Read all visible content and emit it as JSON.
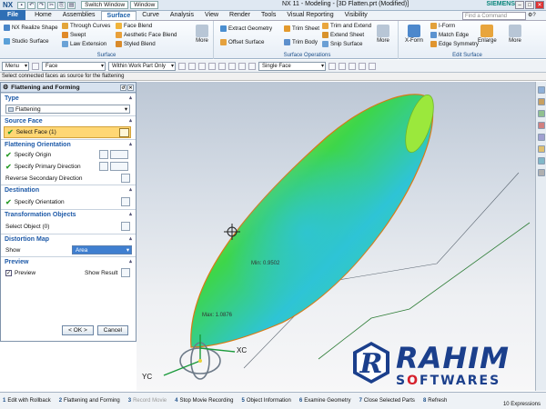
{
  "titlebar": {
    "app_logo": "NX",
    "switch_window": "Switch Window",
    "window_menu": "Window",
    "title": "NX 11 - Modeling - [3D Flatten.prt (Modified)]",
    "brand": "SIEMENS"
  },
  "menubar": {
    "file": "File",
    "tabs": [
      "Home",
      "Assemblies",
      "Surface",
      "Curve",
      "Analysis",
      "View",
      "Render",
      "Tools",
      "Visual Reporting",
      "Visibility"
    ],
    "active_tab": "Surface",
    "find_placeholder": "Find a Command"
  },
  "ribbon": {
    "groups": {
      "surface": "Surface",
      "surface_operations": "Surface Operations",
      "edit_surface": "Edit Surface"
    },
    "buttons": {
      "nx_realize_shape": "NX Realize Shape",
      "studio_surface": "Studio Surface",
      "through_curves": "Through Curves",
      "swept": "Swept",
      "law_extension": "Law Extension",
      "face_blend": "Face Blend",
      "aesthetic_face_blend": "Aesthetic Face Blend",
      "styled_blend": "Styled Blend",
      "more1": "More",
      "extract_geometry": "Extract Geometry",
      "offset_surface": "Offset Surface",
      "trim_sheet": "Trim Sheet",
      "trim_body": "Trim Body",
      "trim_and_extend": "Trim and Extend",
      "extend_sheet": "Extend Sheet",
      "snip_surface": "Snip Surface",
      "more2": "More",
      "x_form": "X-Form",
      "i_form": "I-Form",
      "match_edge": "Match Edge",
      "edge_symmetry": "Edge Symmetry",
      "enlarge": "Enlarge",
      "more3": "More"
    }
  },
  "selbar": {
    "menu": "Menu",
    "filter": "Face",
    "scope": "Within Work Part Only",
    "face_rule": "Single Face"
  },
  "cue": "Select connected faces as source for the flattening",
  "panel": {
    "title": "Flattening and Forming",
    "type_section": "Type",
    "type_value": "Flattening",
    "source_section": "Source Face",
    "select_face": "Select Face (1)",
    "orientation_section": "Flattening Orientation",
    "specify_origin": "Specify Origin",
    "specify_primary_direction": "Specify Primary Direction",
    "reverse_secondary_direction": "Reverse Secondary Direction",
    "destination_section": "Destination",
    "specify_orientation": "Specify Orientation",
    "transformation_section": "Transformation Objects",
    "select_object": "Select Object (0)",
    "distortion_section": "Distortion Map",
    "show_label": "Show",
    "show_value": "Area",
    "preview_section": "Preview",
    "preview_label": "Preview",
    "show_result": "Show Result",
    "ok": "< OK >",
    "cancel": "Cancel"
  },
  "viewport": {
    "min_label": "Min: 0.9502",
    "max_label": "Max: 1.0876",
    "axis_xc": "XC",
    "axis_yc": "YC",
    "axis_zc": "ZC"
  },
  "status": {
    "items": [
      {
        "num": "1",
        "label": "Edit with Rollback"
      },
      {
        "num": "2",
        "label": "Flattening and Forming"
      },
      {
        "num": "3",
        "label": "Record Movie"
      },
      {
        "num": "4",
        "label": "Stop Movie Recording"
      },
      {
        "num": "5",
        "label": "Object Information"
      },
      {
        "num": "6",
        "label": "Examine Geometry"
      },
      {
        "num": "7",
        "label": "Close Selected Parts"
      },
      {
        "num": "8",
        "label": "Refresh"
      }
    ],
    "expressions": "10 Expressions"
  },
  "watermark": {
    "line1": "RAHIM",
    "line2_part1": "S",
    "line2_o": "O",
    "line2_part2": "FTWARES"
  },
  "colors": {
    "accent": "#2e6fb5",
    "surface_green": "#3dd64a",
    "surface_cyan": "#2ec4d6",
    "surface_orange": "#f08a1a",
    "selection_yellow": "#ffd774"
  }
}
